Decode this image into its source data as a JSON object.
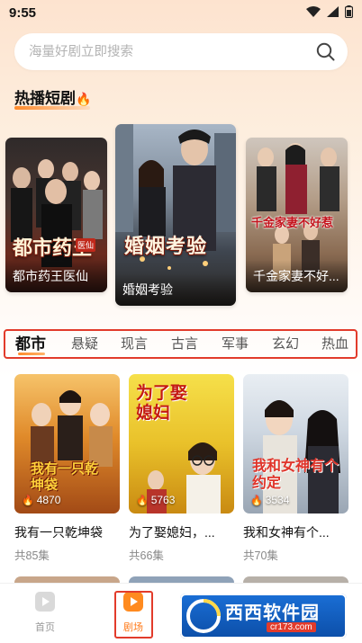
{
  "status_bar": {
    "time": "9:55"
  },
  "search": {
    "placeholder": "海量好剧立即搜索"
  },
  "section": {
    "title": "热播短剧",
    "title_emoji": "🔥"
  },
  "hot_dramas": [
    {
      "caption": "都市药王医仙",
      "overlay": "都市药王",
      "overlay_tag": "医仙"
    },
    {
      "caption": "婚姻考验",
      "overlay": "婚姻考验"
    },
    {
      "caption": "千金家妻不好...",
      "overlay": "千金家妻不好惹"
    }
  ],
  "categories": [
    "都市",
    "悬疑",
    "现言",
    "古言",
    "军事",
    "玄幻",
    "热血"
  ],
  "dramas": [
    {
      "title": "我有一只乾坤袋",
      "episodes": "共85集",
      "heat": "4870",
      "poster_text": "我有一只乾坤袋"
    },
    {
      "title": "为了娶媳妇，...",
      "episodes": "共66集",
      "heat": "5763",
      "poster_text": "为了娶媳妇"
    },
    {
      "title": "我和女神有个...",
      "episodes": "共70集",
      "heat": "3534",
      "poster_text": "我和女神有个约定"
    }
  ],
  "bottom_nav": [
    {
      "label": "首页",
      "icon": "play-square-icon"
    },
    {
      "label": "剧场",
      "icon": "play-badge-icon"
    }
  ],
  "watermark": {
    "brand": "西西软件园",
    "url": "cr173.com"
  },
  "colors": {
    "accent": "#ff7a1a",
    "highlight_border": "#e23b2b"
  }
}
